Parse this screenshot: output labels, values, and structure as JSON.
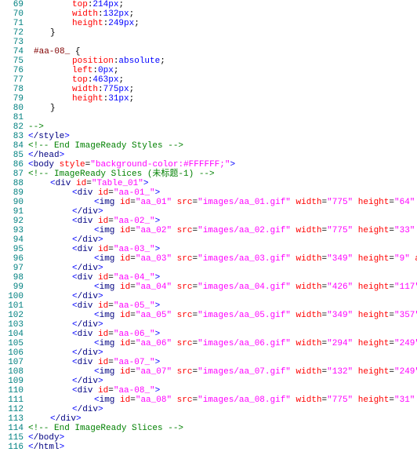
{
  "gutter": {
    "start": 69,
    "end": 116
  },
  "lines": {
    "l69": {
      "prop": "top",
      "val": "214px"
    },
    "l70": {
      "prop": "width",
      "val": "132px"
    },
    "l71": {
      "prop": "height",
      "val": "249px"
    },
    "l72": {
      "brace": "}"
    },
    "l73": "",
    "l74": {
      "sel": "#aa-08_",
      "brace": "{"
    },
    "l75": {
      "prop": "position",
      "val": "absolute"
    },
    "l76": {
      "prop": "left",
      "val": "0px"
    },
    "l77": {
      "prop": "top",
      "val": "463px"
    },
    "l78": {
      "prop": "width",
      "val": "775px"
    },
    "l79": {
      "prop": "height",
      "val": "31px"
    },
    "l80": {
      "brace": "}"
    },
    "l81": "",
    "l82": "-->",
    "l83": {
      "tag": "style",
      "close": true
    },
    "l84": "<!-- End ImageReady Styles -->",
    "l85": {
      "tag": "head",
      "close": true
    },
    "l86": {
      "tag": "body",
      "attr": "style",
      "val": "background-color:#FFFFFF;"
    },
    "l87": "<!-- ImageReady Slices (未标题-1) -->",
    "l88": {
      "tag": "div",
      "attr": "id",
      "val": "Table_01"
    },
    "l89": {
      "tag": "div",
      "attr": "id",
      "val": "aa-01_"
    },
    "l90": {
      "tag": "img",
      "id": "aa_01",
      "src": "images/aa_01.gif",
      "w": "775",
      "h": "64",
      "alt": ""
    },
    "l91": {
      "tag": "div",
      "close": true
    },
    "l92": {
      "tag": "div",
      "attr": "id",
      "val": "aa-02_"
    },
    "l93": {
      "tag": "img",
      "id": "aa_02",
      "src": "images/aa_02.gif",
      "w": "775",
      "h": "33",
      "alt": ""
    },
    "l94": {
      "tag": "div",
      "close": true
    },
    "l95": {
      "tag": "div",
      "attr": "id",
      "val": "aa-03_"
    },
    "l96": {
      "tag": "img",
      "id": "aa_03",
      "src": "images/aa_03.gif",
      "w": "349",
      "h": "9",
      "alt": ""
    },
    "l97": {
      "tag": "div",
      "close": true
    },
    "l98": {
      "tag": "div",
      "attr": "id",
      "val": "aa-04_"
    },
    "l99": {
      "tag": "img",
      "id": "aa_04",
      "src": "images/aa_04.gif",
      "w": "426",
      "h": "117",
      "alt": ""
    },
    "l100": {
      "tag": "div",
      "close": true
    },
    "l101": {
      "tag": "div",
      "attr": "id",
      "val": "aa-05_"
    },
    "l102": {
      "tag": "img",
      "id": "aa_05",
      "src": "images/aa_05.gif",
      "w": "349",
      "h": "357",
      "alt": ""
    },
    "l103": {
      "tag": "div",
      "close": true
    },
    "l104": {
      "tag": "div",
      "attr": "id",
      "val": "aa-06_"
    },
    "l105": {
      "tag": "img",
      "id": "aa_06",
      "src": "images/aa_06.gif",
      "w": "294",
      "h": "249",
      "alt": ""
    },
    "l106": {
      "tag": "div",
      "close": true
    },
    "l107": {
      "tag": "div",
      "attr": "id",
      "val": "aa-07_"
    },
    "l108": {
      "tag": "img",
      "id": "aa_07",
      "src": "images/aa_07.gif",
      "w": "132",
      "h": "249",
      "alt": ""
    },
    "l109": {
      "tag": "div",
      "close": true
    },
    "l110": {
      "tag": "div",
      "attr": "id",
      "val": "aa-08_"
    },
    "l111": {
      "tag": "img",
      "id": "aa_08",
      "src": "images/aa_08.gif",
      "w": "775",
      "h": "31",
      "alt": ""
    },
    "l112": {
      "tag": "div",
      "close": true
    },
    "l113": {
      "tag": "div",
      "close": true
    },
    "l114": "<!-- End ImageReady Slices -->",
    "l115": {
      "tag": "body",
      "close": true
    },
    "l116": {
      "tag": "html",
      "close": true
    }
  }
}
